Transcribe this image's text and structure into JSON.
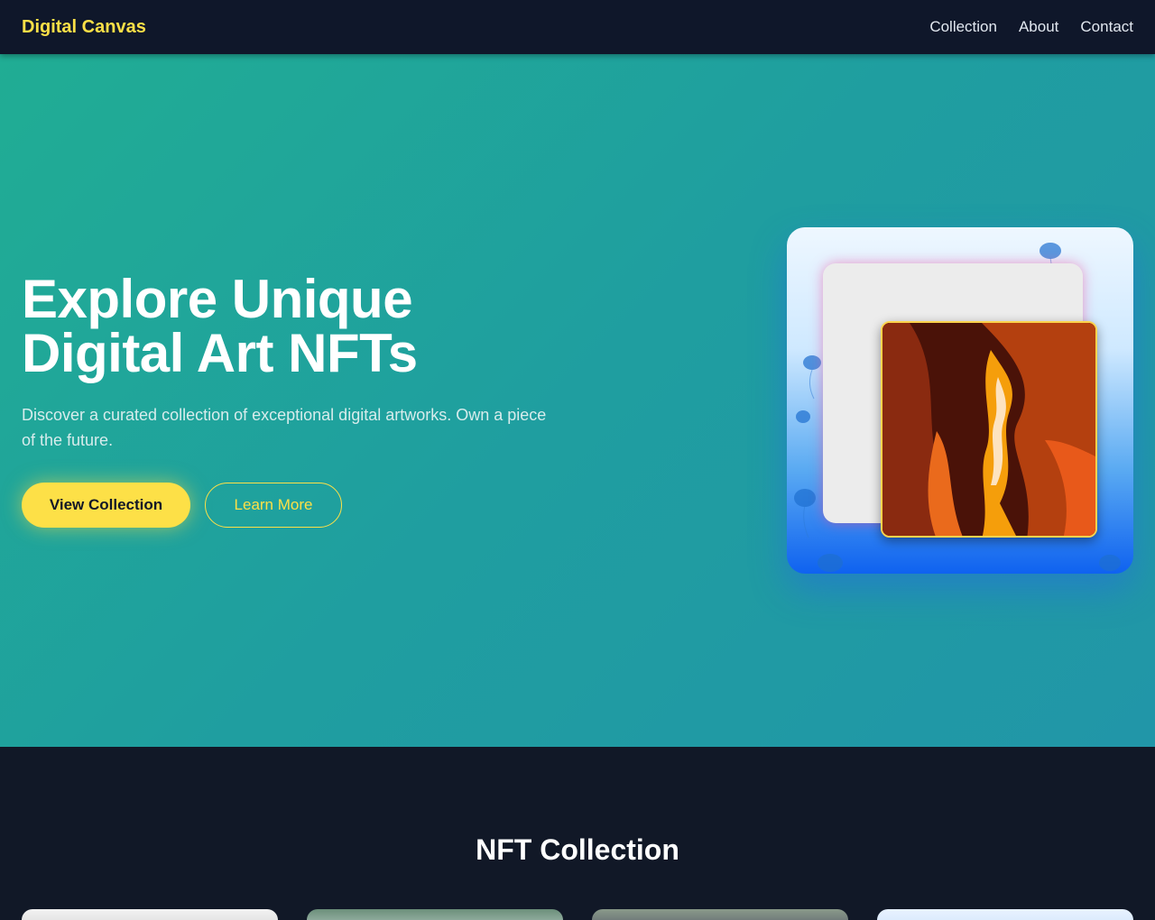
{
  "nav": {
    "logo": "Digital Canvas",
    "links": [
      {
        "label": "Collection"
      },
      {
        "label": "About"
      },
      {
        "label": "Contact"
      }
    ]
  },
  "hero": {
    "title_line1": "Explore Unique",
    "title_line2": "Digital Art NFTs",
    "subtitle": "Discover a curated collection of exceptional digital artworks. Own a piece of the future.",
    "primary_button": "View Collection",
    "secondary_button": "Learn More",
    "colors": {
      "accent": "#fde047",
      "hero_start": "#20ad94",
      "hero_end": "#2196a8",
      "dark": "#0f172a"
    }
  },
  "collection": {
    "title": "NFT Collection",
    "cards": [
      {
        "name": "nft-card-1"
      },
      {
        "name": "nft-card-2"
      },
      {
        "name": "nft-card-3"
      },
      {
        "name": "nft-card-4"
      }
    ]
  }
}
